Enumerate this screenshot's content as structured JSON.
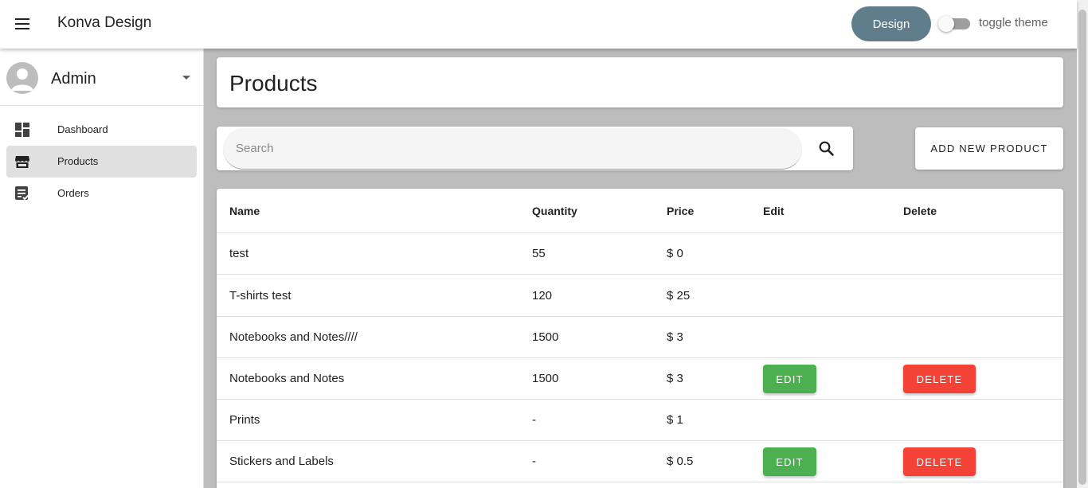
{
  "appbar": {
    "title": "Konva Design",
    "design_button": "Design",
    "toggle_label": "toggle theme"
  },
  "sidebar": {
    "user_name": "Admin",
    "items": [
      {
        "label": "Dashboard",
        "icon": "dashboard-icon"
      },
      {
        "label": "Products",
        "icon": "storefront-icon"
      },
      {
        "label": "Orders",
        "icon": "orders-checklist-icon"
      }
    ]
  },
  "main": {
    "page_title": "Products",
    "search_placeholder": "Search",
    "add_button": "ADD NEW PRODUCT"
  },
  "table": {
    "columns": [
      "Name",
      "Quantity",
      "Price",
      "Edit",
      "Delete"
    ],
    "rows": [
      {
        "name": "test",
        "quantity": "55",
        "price": "$ 0"
      },
      {
        "name": "T-shirts test",
        "quantity": "120",
        "price": "$ 25"
      },
      {
        "name": "Notebooks and Notes////",
        "quantity": "1500",
        "price": "$ 3"
      },
      {
        "name": "Notebooks and Notes",
        "quantity": "1500",
        "price": "$ 3",
        "edit": "EDIT",
        "delete": "DELETE"
      },
      {
        "name": "Prints",
        "quantity": "-",
        "price": "$ 1"
      },
      {
        "name": "Stickers and Labels",
        "quantity": "-",
        "price": "$ 0.5",
        "edit": "EDIT",
        "delete": "DELETE"
      }
    ]
  },
  "colors": {
    "design_button": "#607d8b",
    "edit_button": "#4caf50",
    "delete_button": "#f44336",
    "content_background": "#bdbdbd",
    "active_nav": "#e0e0e0"
  }
}
